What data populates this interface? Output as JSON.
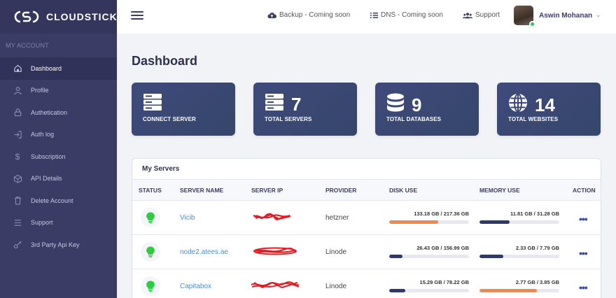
{
  "app": {
    "logo_text": "CLOUDSTICK"
  },
  "sidebar": {
    "section": "MY ACCOUNT",
    "items": [
      {
        "label": "Dashboard",
        "icon": "home-icon",
        "active": true
      },
      {
        "label": "Profile",
        "icon": "user-icon"
      },
      {
        "label": "Authetication",
        "icon": "lock-icon"
      },
      {
        "label": "Auth log",
        "icon": "sign-in-icon"
      },
      {
        "label": "Subscription",
        "icon": "dollar-icon"
      },
      {
        "label": "API Details",
        "icon": "cube-icon"
      },
      {
        "label": "Delete Account",
        "icon": "trash-icon"
      },
      {
        "label": "Support",
        "icon": "list-icon"
      },
      {
        "label": "3rd Party Api Key",
        "icon": "key-icon"
      }
    ]
  },
  "topbar": {
    "backup": "Backup - Coming soon",
    "dns": "DNS - Coming soon",
    "support": "Support",
    "user_name": "Aswin Mohanan"
  },
  "page_title": "Dashboard",
  "cards": [
    {
      "number": "",
      "label": "CONNECT SERVER",
      "icon": "server-icon"
    },
    {
      "number": "7",
      "label": "TOTAL SERVERS",
      "icon": "server-icon"
    },
    {
      "number": "9",
      "label": "TOTAL DATABASES",
      "icon": "database-icon"
    },
    {
      "number": "14",
      "label": "TOTAL WEBSITES",
      "icon": "globe-icon"
    }
  ],
  "servers": {
    "title": "My Servers",
    "columns": [
      "STATUS",
      "SERVER NAME",
      "SERVER IP",
      "PROVIDER",
      "DISK USE",
      "MEMORY USE",
      "ACTION"
    ],
    "rows": [
      {
        "name": "Vicib",
        "provider": "hetzner",
        "disk_text": "133.18 GB / 217.36 GB",
        "disk_pct": 0.61,
        "mem_text": "11.81 GB / 31.28 GB",
        "mem_pct": 0.38,
        "action": "•••"
      },
      {
        "name": "node2.atees.ae",
        "provider": "Linode",
        "disk_text": "26.43 GB / 156.99 GB",
        "disk_pct": 0.17,
        "mem_text": "2.33 GB / 7.79 GB",
        "mem_pct": 0.3,
        "action": "•••"
      },
      {
        "name": "Capitabox",
        "provider": "Linode",
        "disk_text": "15.29 GB / 78.22 GB",
        "disk_pct": 0.2,
        "mem_text": "2.77 GB / 3.85 GB",
        "mem_pct": 0.72,
        "action": "•••"
      }
    ]
  },
  "colors": {
    "sidebar": "#3a3c66",
    "accent_orange": "#f08a4b",
    "accent_navy": "#2f3a6b",
    "link": "#4a8fd8",
    "status_green": "#2ecc40",
    "redaction": "#e31b23"
  }
}
